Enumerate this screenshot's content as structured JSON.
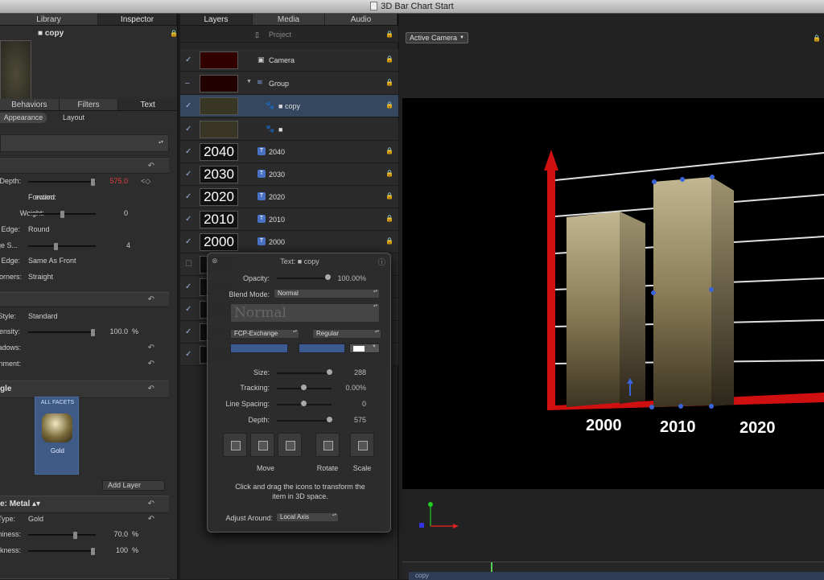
{
  "window": {
    "title": "3D Bar Chart Start"
  },
  "left_panel": {
    "tabs": [
      "Library",
      "Inspector"
    ],
    "selection_name": "copy",
    "sub_tabs": [
      "Behaviors",
      "Filters",
      "Text"
    ],
    "segment_tabs": [
      "Appearance",
      "Layout"
    ],
    "rows": [
      {
        "label": "Depth:",
        "value": "575.0"
      },
      {
        "label": "ection:",
        "value": "Forward"
      },
      {
        "label": "Weight:",
        "value": "0"
      },
      {
        "label": "Edge:",
        "value": "Round"
      },
      {
        "label": "ge S...",
        "value": "4"
      },
      {
        "label": "Edge:",
        "value": "Same As Front"
      },
      {
        "label": "orners:",
        "value": "Straight"
      },
      {
        "label": "Style:",
        "value": "Standard"
      },
      {
        "label": "ensity:",
        "value": "100.0",
        "unit": "%"
      },
      {
        "label": "adows:",
        "value": ""
      },
      {
        "label": "nment:",
        "value": ""
      }
    ],
    "facet_section": "gle",
    "facet": {
      "header": "ALL FACETS",
      "name": "Gold"
    },
    "add_layer": "Add Layer",
    "material": {
      "label": "e:",
      "value": "Metal"
    },
    "type": {
      "label": "Type:",
      "value": "Gold"
    },
    "shininess": {
      "label": "hiness:",
      "value": "70.0",
      "unit": "%"
    },
    "roughness": {
      "label": "kness:",
      "value": "100",
      "unit": "%"
    }
  },
  "layers_panel": {
    "tabs": [
      "Layers",
      "Media",
      "Audio"
    ],
    "rows": [
      {
        "name": "Project"
      },
      {
        "name": "Camera"
      },
      {
        "name": "Group"
      },
      {
        "name": "copy"
      },
      {
        "name": "■"
      },
      {
        "name": "2040",
        "thumb": "2040"
      },
      {
        "name": "2030",
        "thumb": "2030"
      },
      {
        "name": "2020",
        "thumb": "2020"
      },
      {
        "name": "2010",
        "thumb": "2010"
      },
      {
        "name": "2000",
        "thumb": "2000"
      }
    ]
  },
  "hud": {
    "title": "Text: ■ copy",
    "opacity": {
      "label": "Opacity:",
      "value": "100.00%"
    },
    "blend": {
      "label": "Blend Mode:",
      "value": "Normal"
    },
    "preset": "Normal",
    "font": "FCP-Exchange",
    "style": "Regular",
    "size": {
      "label": "Size:",
      "value": "288"
    },
    "tracking": {
      "label": "Tracking:",
      "value": "0.00%"
    },
    "line_spacing": {
      "label": "Line Spacing:",
      "value": "0"
    },
    "depth": {
      "label": "Depth:",
      "value": "575"
    },
    "move": "Move",
    "rotate": "Rotate",
    "scale": "Scale",
    "hint": "Click and drag the icons to transform the item in 3D space.",
    "adjust": {
      "label": "Adjust Around:",
      "value": "Local Axis"
    }
  },
  "viewer": {
    "camera_menu": "Active Camera",
    "years": [
      "2000",
      "2010",
      "2020"
    ],
    "timeline_label": "copy"
  }
}
